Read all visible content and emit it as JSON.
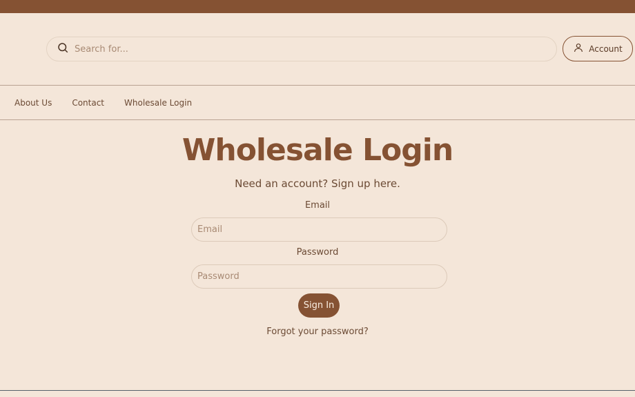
{
  "header": {
    "search_placeholder": "Search for...",
    "search_icon": "search-icon",
    "account_label": "Account",
    "account_icon": "user-icon"
  },
  "nav": {
    "items": [
      "About Us",
      "Contact",
      "Wholesale Login"
    ]
  },
  "main": {
    "title": "Wholesale Login",
    "subtitle": "Need an account? Sign up here.",
    "email_label": "Email",
    "email_placeholder": "Email",
    "password_label": "Password",
    "password_placeholder": "Password",
    "signin_label": "Sign In",
    "forgot_label": "Forgot your password?"
  },
  "colors": {
    "brand": "#855233",
    "background": "#f4e6d9",
    "text": "#6b4a34"
  }
}
